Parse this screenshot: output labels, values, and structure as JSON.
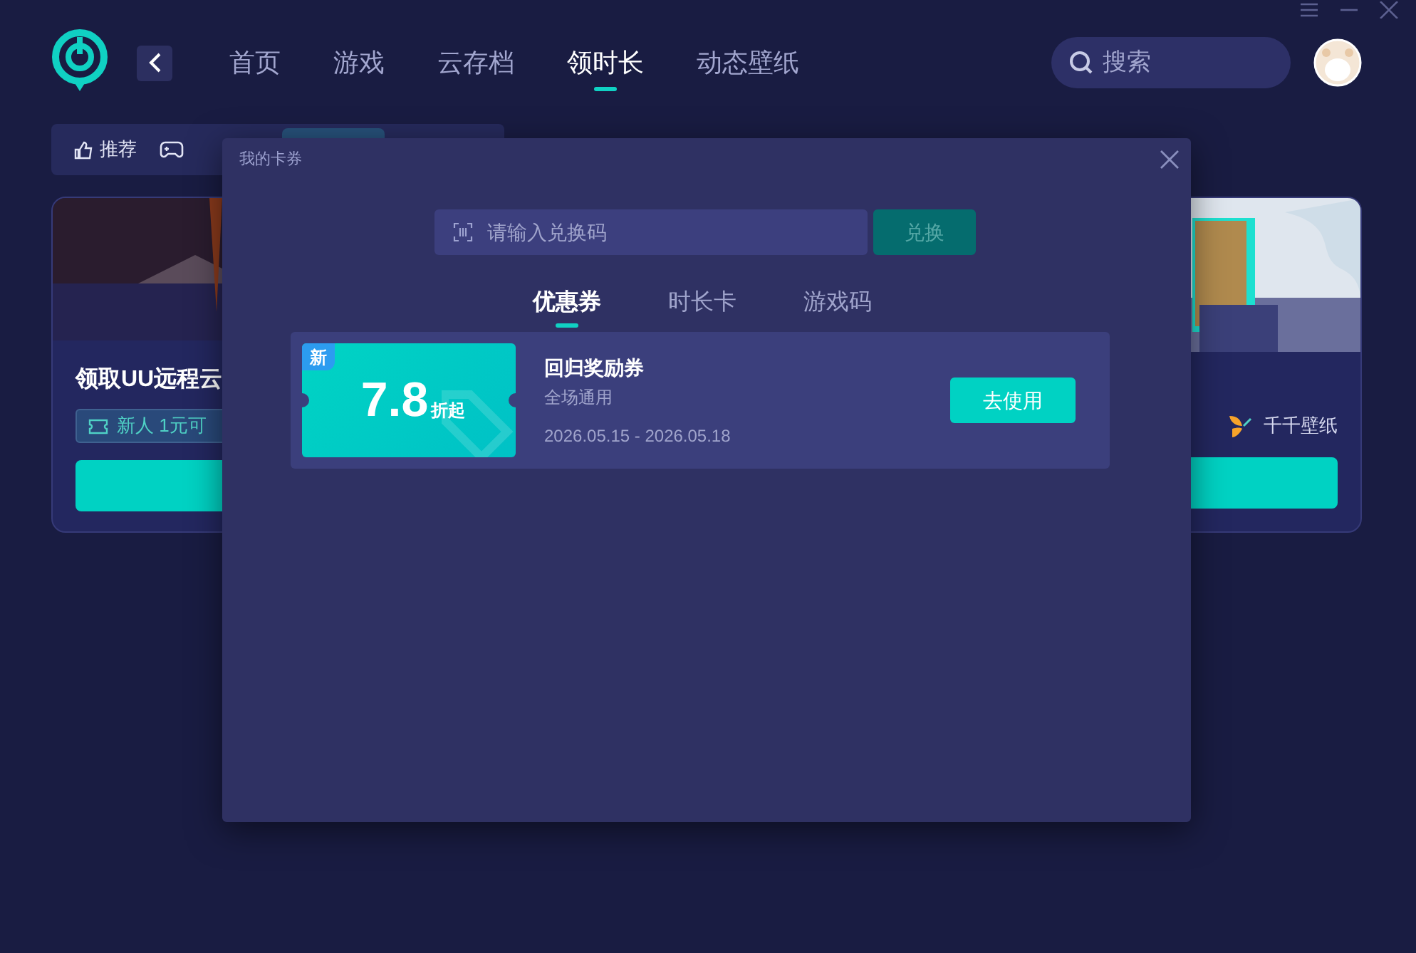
{
  "nav": [
    {
      "label": "首页",
      "selected": false
    },
    {
      "label": "游戏",
      "selected": false
    },
    {
      "label": "云存档",
      "selected": false
    },
    {
      "label": "领时长",
      "selected": true
    },
    {
      "label": "动态壁纸",
      "selected": false
    }
  ],
  "search": {
    "placeholder": "搜索"
  },
  "subtabs": [
    {
      "label": "推荐"
    }
  ],
  "left_card": {
    "title": "领取UU远程云",
    "tag": "新人 1元可"
  },
  "right_card": {
    "brand": "千千壁纸"
  },
  "dialog": {
    "title": "我的卡券",
    "redeem": {
      "placeholder": "请输入兑换码",
      "button": "兑换"
    },
    "tabs": [
      {
        "label": "优惠券",
        "selected": true
      },
      {
        "label": "时长卡",
        "selected": false
      },
      {
        "label": "游戏码",
        "selected": false
      }
    ],
    "coupons": [
      {
        "badge": "新",
        "value": "7.8",
        "unit": "折起",
        "name": "回归奖励券",
        "scope": "全场通用",
        "period": "2026.05.15 - 2026.05.18",
        "action": "去使用"
      }
    ]
  }
}
